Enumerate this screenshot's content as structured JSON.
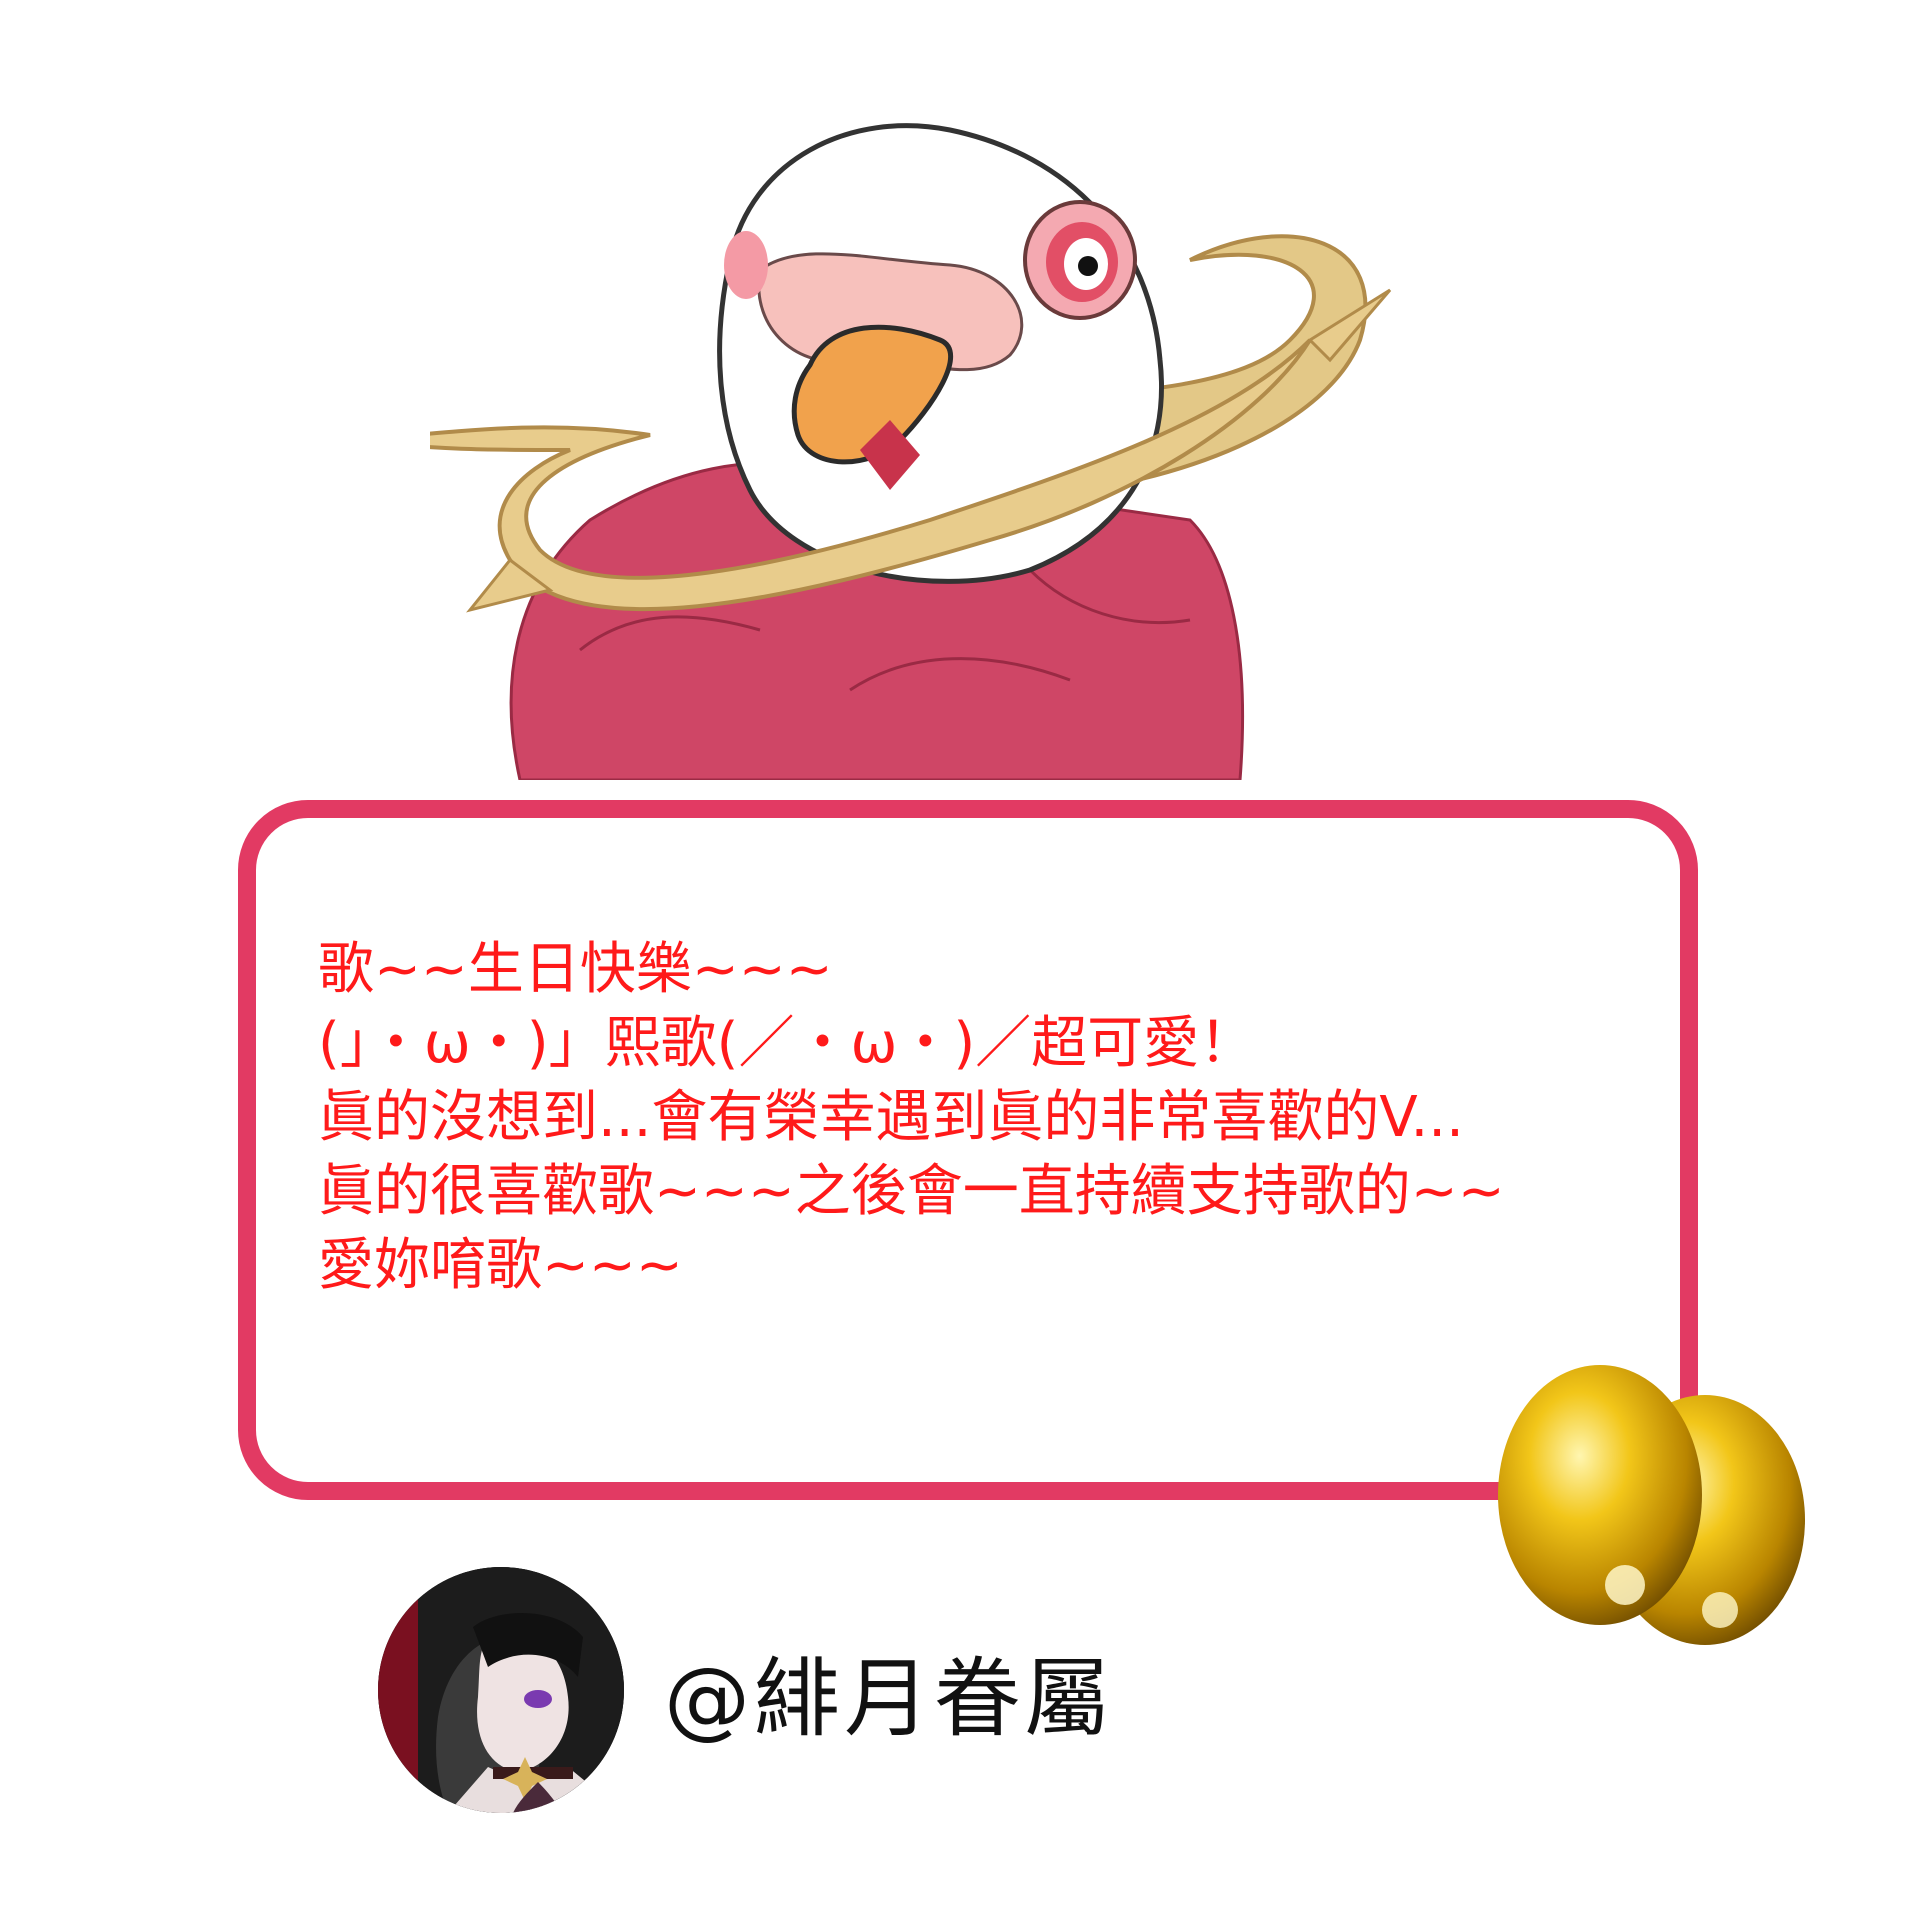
{
  "message": {
    "lines": [
      "歌~~生日快樂~~~",
      "(」・ω・)」熙歌(／・ω・)／超可愛！",
      "眞的沒想到...會有榮幸遇到眞的非常喜歡的V...",
      "眞的很喜歡歌~~~之後會一直持續支持歌的~~",
      "愛妳唷歌~~~"
    ]
  },
  "author": {
    "handle": "@緋月眷屬",
    "avatar_icon": "avatar-portrait"
  },
  "decorations": {
    "top_image_icon": "white-bird-with-golden-halo",
    "corner_image_icon": "golden-eggs"
  },
  "colors": {
    "card_border": "#e23a63",
    "message_text": "#ff1a1a",
    "author_text": "#111111",
    "background": "#ffffff"
  }
}
